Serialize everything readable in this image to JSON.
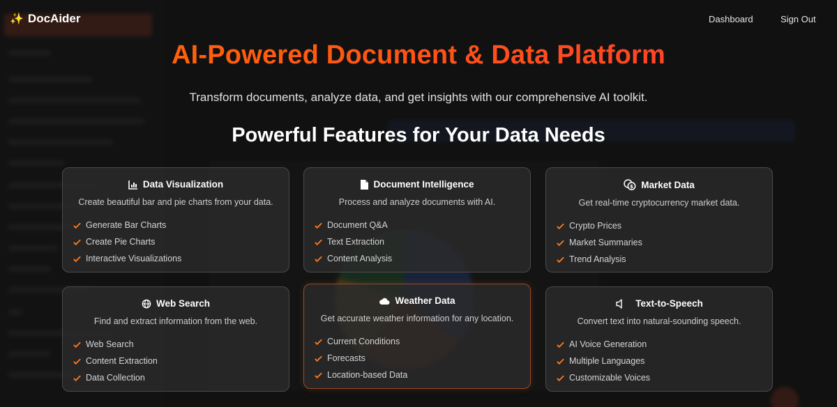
{
  "header": {
    "brand_icon": "sparkles-icon",
    "brand_name": "DocAider",
    "nav": {
      "dashboard": "Dashboard",
      "sign_out": "Sign Out"
    }
  },
  "hero": {
    "title": "AI-Powered Document & Data Platform",
    "subtitle": "Transform documents, analyze data, and get insights with our comprehensive AI toolkit."
  },
  "features": {
    "section_title": "Powerful Features for Your Data Needs",
    "cards": [
      {
        "icon": "chart-icon",
        "title": "Data Visualization",
        "description": "Create beautiful bar and pie charts from your data.",
        "items": [
          "Generate Bar Charts",
          "Create Pie Charts",
          "Interactive Visualizations"
        ]
      },
      {
        "icon": "document-icon",
        "title": "Document Intelligence",
        "description": "Process and analyze documents with AI.",
        "items": [
          "Document Q&A",
          "Text Extraction",
          "Content Analysis"
        ]
      },
      {
        "icon": "coins-icon",
        "title": "Market Data",
        "description": "Get real-time cryptocurrency market data.",
        "items": [
          "Crypto Prices",
          "Market Summaries",
          "Trend Analysis"
        ]
      },
      {
        "icon": "globe-icon",
        "title": "Web Search",
        "description": "Find and extract information from the web.",
        "items": [
          "Web Search",
          "Content Extraction",
          "Data Collection"
        ]
      },
      {
        "icon": "cloud-icon",
        "title": "Weather Data",
        "description": "Get accurate weather information for any location.",
        "items": [
          "Current Conditions",
          "Forecasts",
          "Location-based Data"
        ]
      },
      {
        "icon": "speaker-icon",
        "title": "Text-to-Speech",
        "description": "Convert text into natural-sounding speech.",
        "items": [
          "AI Voice Generation",
          "Multiple Languages",
          "Customizable Voices"
        ]
      }
    ]
  },
  "colors": {
    "accent": "#ff5a1f",
    "check": "#ff7a1a",
    "background": "#161616"
  }
}
